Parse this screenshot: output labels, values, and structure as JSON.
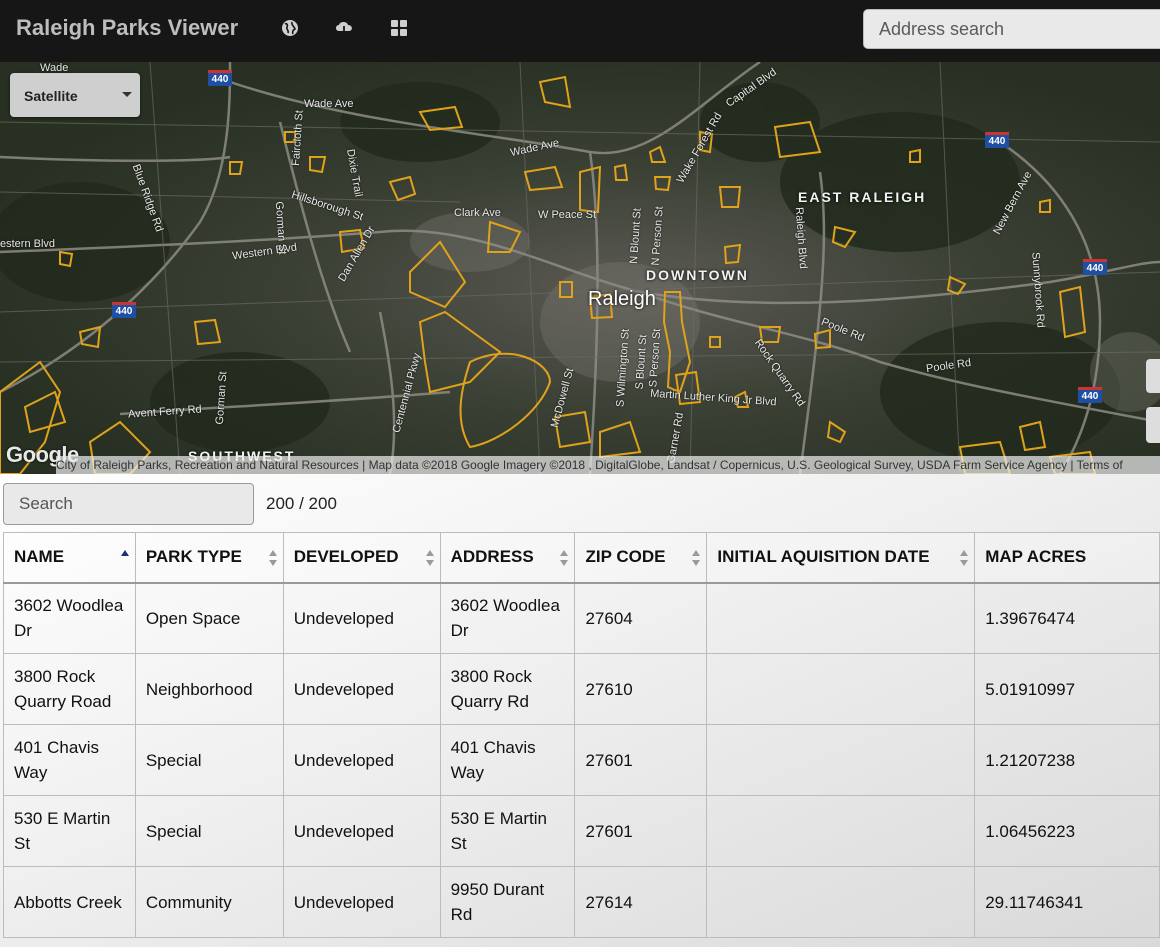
{
  "app": {
    "title": "Raleigh Parks Viewer"
  },
  "toolbar": {
    "icons": [
      "globe-icon",
      "cloud-download-icon",
      "grid-icon"
    ]
  },
  "address_search": {
    "placeholder": "Address search"
  },
  "map": {
    "basemap": "Satellite",
    "google_logo": "Google",
    "attribution": "City of Raleigh Parks, Recreation and Natural Resources  |  Map data ©2018 Google Imagery ©2018 , DigitalGlobe, Landsat / Copernicus, U.S. Geological Survey, USDA Farm Service Agency  |  Terms of",
    "labels": {
      "east_raleigh": "EAST RALEIGH",
      "downtown": "DOWNTOWN",
      "raleigh": "Raleigh",
      "southwest": "SOUTHWEST",
      "wade_ave": "Wade Ave",
      "wade_ave_2": "Wade Ave",
      "capital_blvd": "Capital Blvd",
      "hillsborough": "Hillsborough St",
      "western_blvd": "Western Blvd",
      "western_blvd_2": "estern Blvd",
      "clark_ave": "Clark Ave",
      "w_peace": "W Peace St",
      "poole_rd": "Poole Rd",
      "poole_rd_2": "Poole Rd",
      "avent_ferry": "Avent Ferry Rd",
      "mlk": "Martin Luther King Jr Blvd",
      "new_bern": "New Bern Ave",
      "sunnybrook": "Sunnybrook Rd",
      "raleigh_blvd": "Raleigh Blvd",
      "rock_quarry": "Rock Quarry Rd",
      "gorman": "Gorman St",
      "gorman_2": "Gorman St",
      "centennial": "Centennial Pkwy",
      "blue_ridge": "Blue Ridge Rd",
      "dixie": "Dixie Trail",
      "dan_allen": "Dan Allen Dr",
      "mcdowell": "McDowell St",
      "n_blount": "N Blount St",
      "n_person": "N Person St",
      "s_blount": "S Blount St",
      "s_person": "S Person St",
      "s_wilmington": "S Wilmington St",
      "wake_forest": "Wake Forest Rd",
      "faircloth": "Faircloth St",
      "garner": "Garner Rd",
      "wade_top": "Wade"
    },
    "shields": [
      "440",
      "440",
      "440",
      "440",
      "440"
    ]
  },
  "table_search": {
    "placeholder": "Search"
  },
  "result_count": "200 / 200",
  "table": {
    "columns": [
      "NAME",
      "PARK TYPE",
      "DEVELOPED",
      "ADDRESS",
      "ZIP CODE",
      "INITIAL AQUISITION DATE",
      "MAP ACRES"
    ],
    "sort_column": "NAME",
    "rows": [
      {
        "name": "3602 Woodlea Dr",
        "park_type": "Open Space",
        "developed": "Undeveloped",
        "address": "3602 Woodlea Dr",
        "zip": "27604",
        "acq_date": "",
        "acres": "1.39676474"
      },
      {
        "name": "3800 Rock Quarry Road",
        "park_type": "Neighborhood",
        "developed": "Undeveloped",
        "address": "3800 Rock Quarry Rd",
        "zip": "27610",
        "acq_date": "",
        "acres": "5.01910997"
      },
      {
        "name": "401 Chavis Way",
        "park_type": "Special",
        "developed": "Undeveloped",
        "address": "401 Chavis Way",
        "zip": "27601",
        "acq_date": "",
        "acres": "1.21207238"
      },
      {
        "name": "530 E Martin St",
        "park_type": "Special",
        "developed": "Undeveloped",
        "address": "530 E Martin St",
        "zip": "27601",
        "acq_date": "",
        "acres": "1.06456223"
      },
      {
        "name": "Abbotts Creek",
        "park_type": "Community",
        "developed": "Undeveloped",
        "address": "9950 Durant Rd",
        "zip": "27614",
        "acq_date": "",
        "acres": "29.11746341"
      }
    ]
  },
  "colors": {
    "park_outline": "#e0a21a",
    "topbar": "#161616"
  }
}
